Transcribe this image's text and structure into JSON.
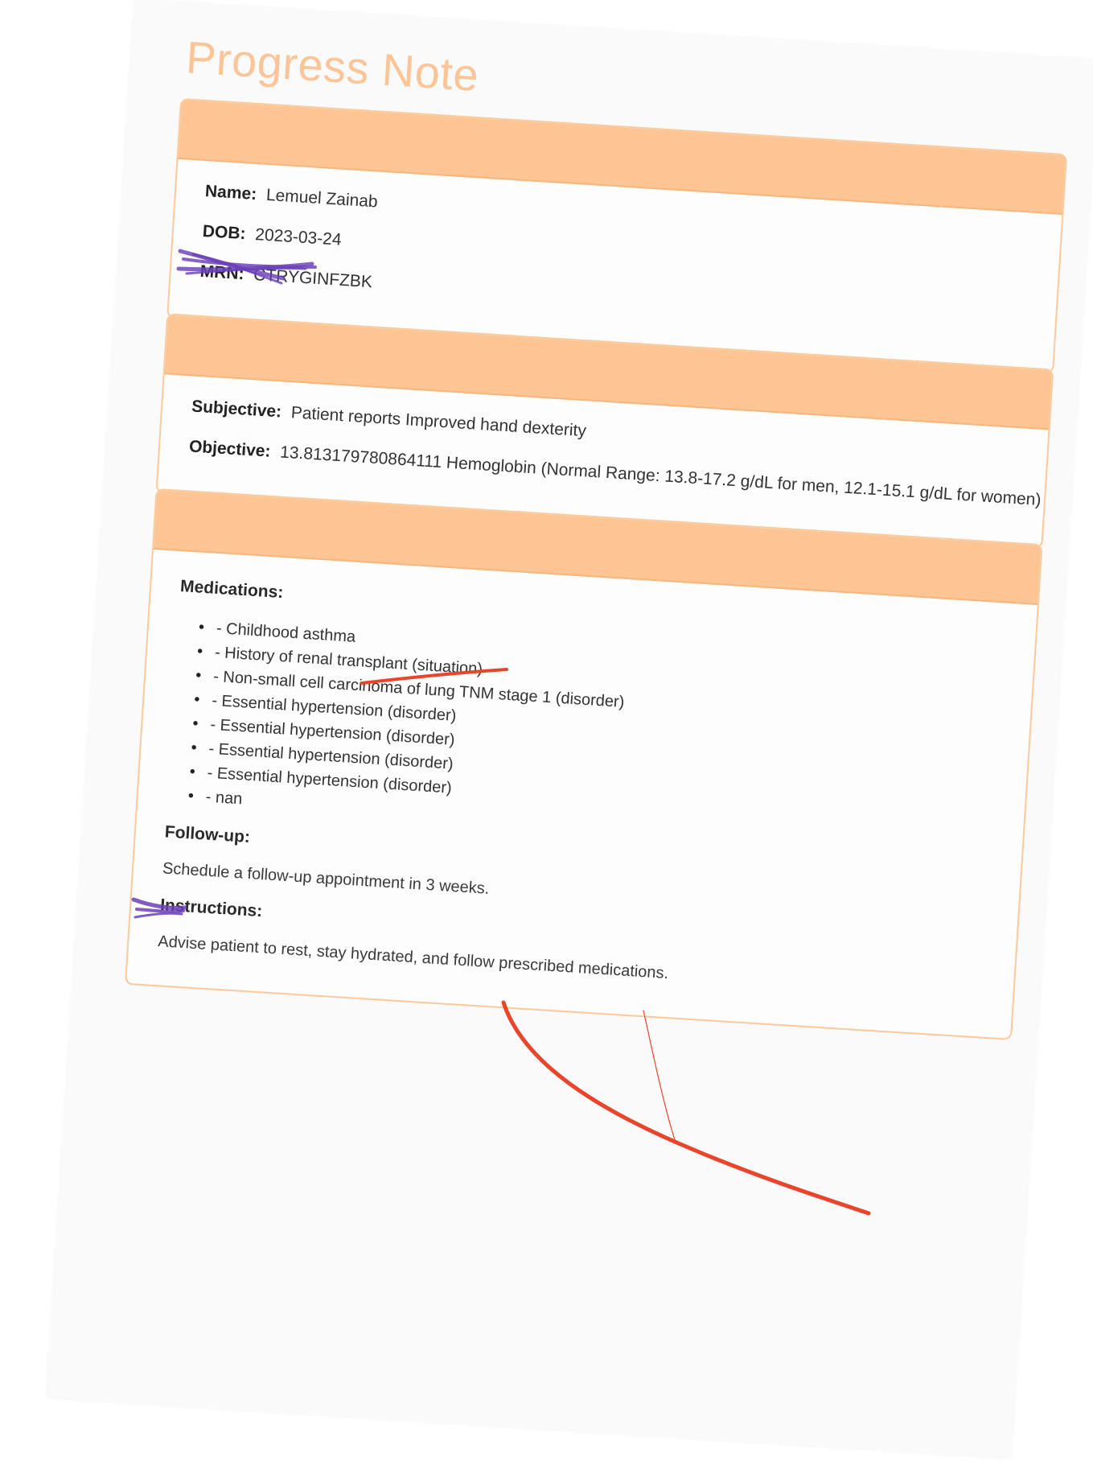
{
  "title": "Progress Note",
  "patient": {
    "name_label": "Name:",
    "name_value": "Lemuel Zainab",
    "dob_label": "DOB:",
    "dob_value": "2023-03-24",
    "mrn_label": "MRN:",
    "mrn_value": "CTRYGINFZBK"
  },
  "assessment": {
    "subjective_label": "Subjective:",
    "subjective_value": "Patient reports Improved hand dexterity",
    "objective_label": "Objective:",
    "objective_value": "13.813179780864111 Hemoglobin (Normal Range: 13.8-17.2 g/dL for men, 12.1-15.1 g/dL for women)"
  },
  "plan": {
    "medications_label": "Medications:",
    "medications": [
      "- Childhood asthma",
      "- History of renal transplant (situation)",
      "- Non-small cell carcinoma of lung TNM stage 1 (disorder)",
      "- Essential hypertension (disorder)",
      "- Essential hypertension (disorder)",
      "- Essential hypertension (disorder)",
      "- Essential hypertension (disorder)",
      "- nan"
    ],
    "followup_label": "Follow-up:",
    "followup_text": "Schedule a follow-up appointment in 3 weeks.",
    "instructions_label": "Instructions:",
    "instructions_text": "Advise patient to rest, stay hydrated, and follow prescribed medications."
  },
  "colors": {
    "accent": "#fdc594",
    "title": "#fcc597",
    "scribble_purple": "#6a3fb8",
    "pen_red": "#e8452a"
  }
}
